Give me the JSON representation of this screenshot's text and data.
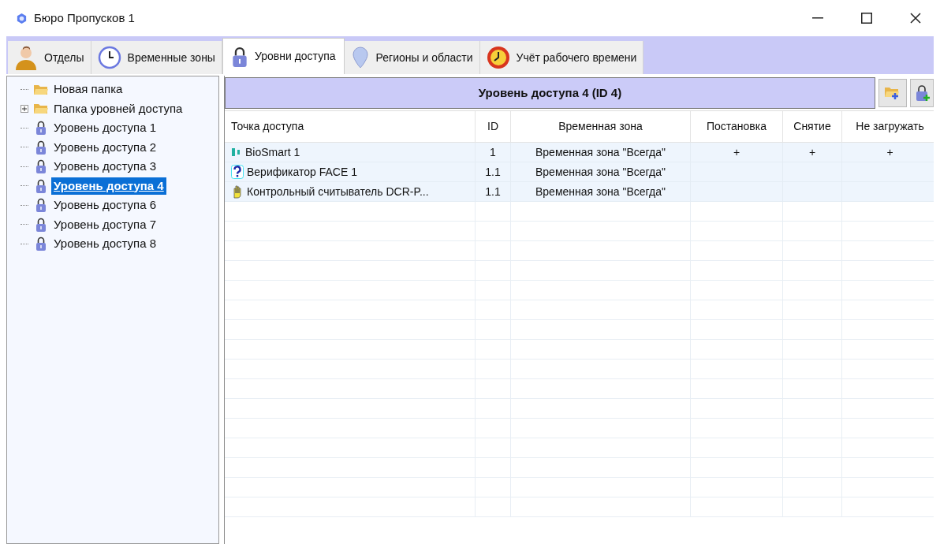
{
  "window": {
    "title": "Бюро Пропусков 1"
  },
  "tabs": [
    {
      "label": "Отделы",
      "kind": "person",
      "selected": false
    },
    {
      "label": "Временные зоны",
      "kind": "clock",
      "selected": false
    },
    {
      "label": "Уровни доступа",
      "kind": "lock",
      "selected": true
    },
    {
      "label": "Регионы и области",
      "kind": "pin",
      "selected": false
    },
    {
      "label": "Учёт рабочего времени",
      "kind": "alarm",
      "selected": false
    }
  ],
  "tree": [
    {
      "label": "Новая папка",
      "kind": "folder",
      "selected": false
    },
    {
      "label": "Папка уровней доступа",
      "kind": "folder",
      "expanded": false,
      "selected": false
    },
    {
      "label": "Уровень доступа 1",
      "kind": "lock",
      "selected": false
    },
    {
      "label": "Уровень доступа 2",
      "kind": "lock",
      "selected": false
    },
    {
      "label": "Уровень доступа 3",
      "kind": "lock",
      "selected": false
    },
    {
      "label": "Уровень доступа 4",
      "kind": "lock",
      "selected": true
    },
    {
      "label": "Уровень доступа 6",
      "kind": "lock",
      "selected": false
    },
    {
      "label": "Уровень доступа 7",
      "kind": "lock",
      "selected": false
    },
    {
      "label": "Уровень доступа 8",
      "kind": "lock",
      "selected": false
    }
  ],
  "panel": {
    "title": "Уровень доступа 4 (ID 4)"
  },
  "table": {
    "columns": [
      "Точка доступа",
      "ID",
      "Временная зона",
      "Постановка",
      "Снятие",
      "Не загружать"
    ],
    "rows": [
      {
        "kind": "biosmart",
        "cells": [
          "BioSmart 1",
          "1",
          "Временная зона \"Всегда\"",
          "+",
          "+",
          "+"
        ]
      },
      {
        "kind": "face",
        "cells": [
          "Верификатор FACE 1",
          "1.1",
          "Временная зона \"Всегда\"",
          "",
          "",
          ""
        ]
      },
      {
        "kind": "reader",
        "cells": [
          "Контрольный считыватель DCR-P...",
          "1.1",
          "Временная зона \"Всегда\"",
          "",
          "",
          ""
        ]
      }
    ]
  }
}
